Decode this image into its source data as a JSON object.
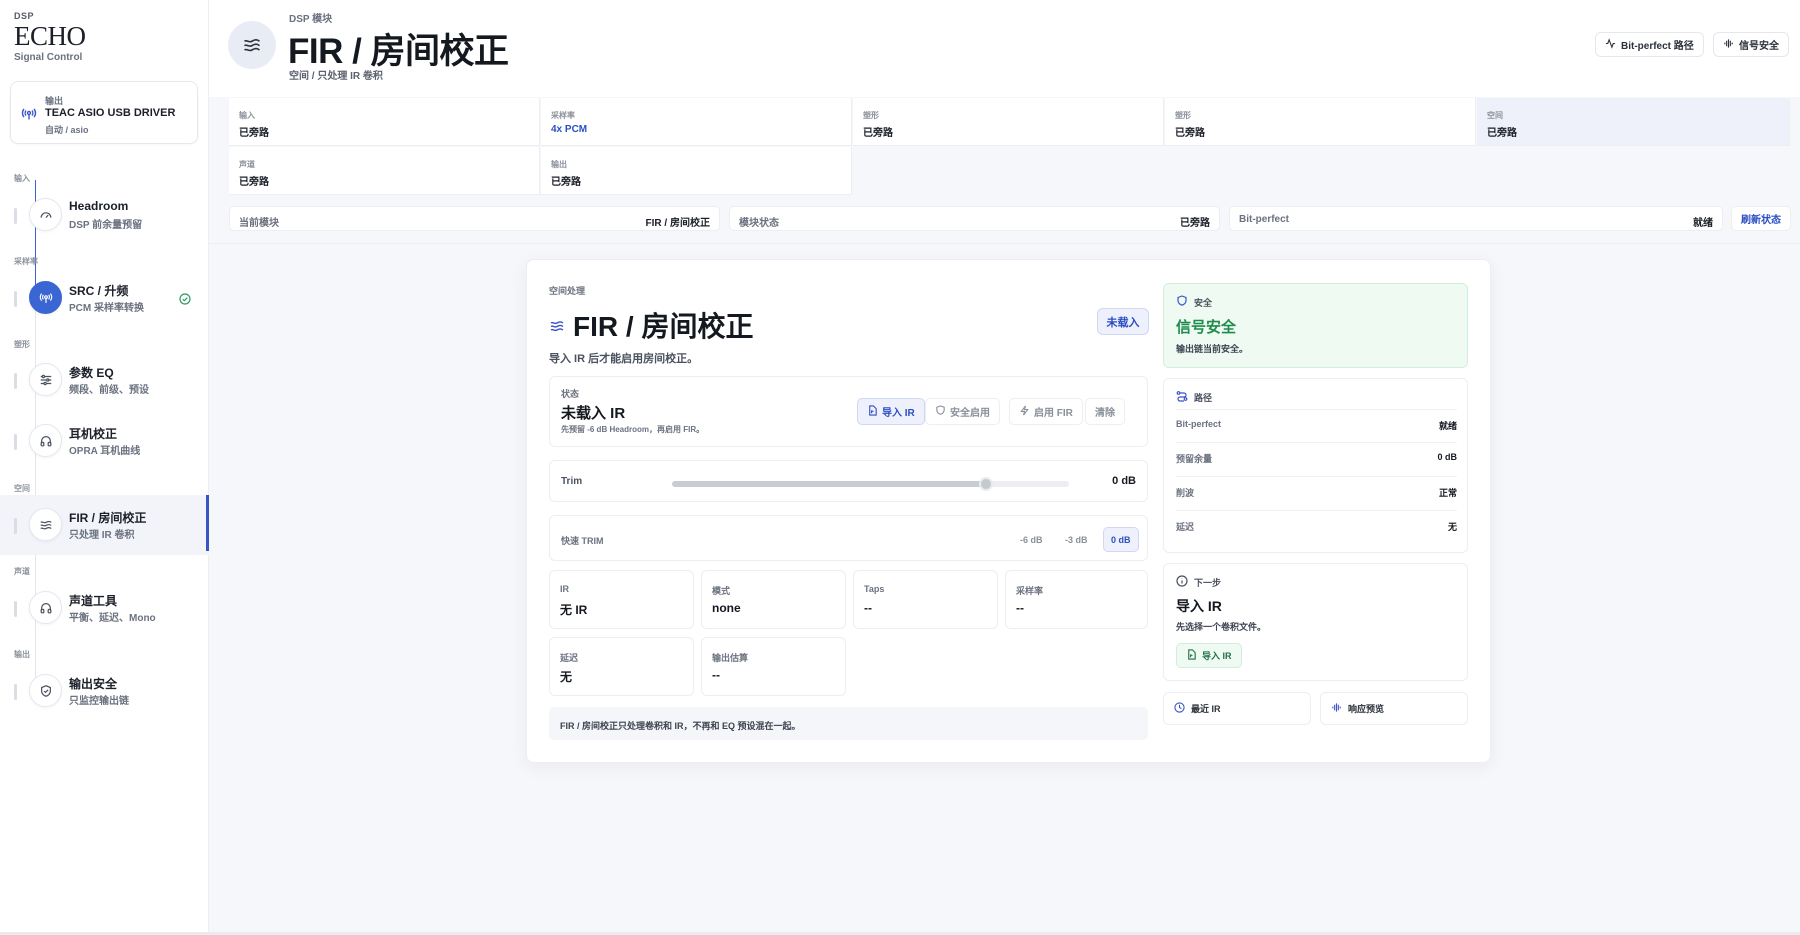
{
  "brand": {
    "small": "DSP",
    "title": "ECHO",
    "subtitle": "Signal Control"
  },
  "device": {
    "label": "输出",
    "name": "TEAC ASIO USB DRIVER",
    "sub": "自动 / asio"
  },
  "sidebar": {
    "sections": [
      "输入",
      "采样率",
      "塑形",
      "空间",
      "声道",
      "输出"
    ],
    "items": [
      {
        "title": "Headroom",
        "sub": "DSP 前余量预留",
        "icon": "gauge-icon"
      },
      {
        "title": "SRC / 升频",
        "sub": "PCM 采样率转换",
        "icon": "antenna-icon"
      },
      {
        "title": "参数 EQ",
        "sub": "频段、前级、预设",
        "icon": "sliders-icon"
      },
      {
        "title": "耳机校正",
        "sub": "OPRA 耳机曲线",
        "icon": "headphones-icon"
      },
      {
        "title": "FIR / 房间校正",
        "sub": "只处理 IR 卷积",
        "icon": "waves-icon"
      },
      {
        "title": "声道工具",
        "sub": "平衡、延迟、Mono",
        "icon": "headphones-icon"
      },
      {
        "title": "输出安全",
        "sub": "只监控输出链",
        "icon": "shield-icon"
      }
    ]
  },
  "header": {
    "overline": "DSP 模块",
    "title": "FIR / 房间校正",
    "subtitle": "空间 / 只处理 IR 卷积",
    "btn_bitperfect": "Bit-perfect 路径",
    "btn_safe": "信号安全"
  },
  "status_grid": [
    {
      "label": "输入",
      "value": "已旁路"
    },
    {
      "label": "采样率",
      "value": "4x PCM"
    },
    {
      "label": "塑形",
      "value": "已旁路"
    },
    {
      "label": "塑形",
      "value": "已旁路"
    },
    {
      "label": "空间",
      "value": "已旁路"
    },
    {
      "label": "声道",
      "value": "已旁路"
    },
    {
      "label": "输出",
      "value": "已旁路"
    }
  ],
  "status_row": [
    {
      "key": "当前模块",
      "value": "FIR / 房间校正"
    },
    {
      "key": "模块状态",
      "value": "已旁路"
    },
    {
      "key": "Bit-perfect",
      "value": "就绪"
    }
  ],
  "refresh_label": "刷新状态",
  "card": {
    "overline": "空间处理",
    "title": "FIR / 房间校正",
    "desc": "导入 IR 后才能启用房间校正。",
    "badge": "未载入",
    "state": {
      "label": "状态",
      "value": "未载入 IR",
      "hint": "先预留 -6 dB Headroom，再启用 FIR。",
      "actions": [
        "导入 IR",
        "安全启用",
        "启用 FIR",
        "清除"
      ]
    },
    "trim": {
      "label": "Trim",
      "value": "0 dB",
      "fraction": 0.79
    },
    "quick": {
      "label": "快速 TRIM",
      "options": [
        "-6 dB",
        "-3 dB",
        "0 dB"
      ],
      "selected": 2
    },
    "tiles": [
      {
        "label": "IR",
        "value": "无 IR"
      },
      {
        "label": "模式",
        "value": "none"
      },
      {
        "label": "Taps",
        "value": "--"
      },
      {
        "label": "采样率",
        "value": "--"
      },
      {
        "label": "延迟",
        "value": "无"
      },
      {
        "label": "输出估算",
        "value": "--"
      }
    ],
    "note": "FIR / 房间校正只处理卷积和 IR，不再和 EQ 预设混在一起。"
  },
  "safe": {
    "label": "安全",
    "value": "信号安全",
    "desc": "输出链当前安全。"
  },
  "path": {
    "label": "路径",
    "rows": [
      {
        "key": "Bit-perfect",
        "value": "就绪"
      },
      {
        "key": "预留余量",
        "value": "0 dB"
      },
      {
        "key": "削波",
        "value": "正常"
      },
      {
        "key": "延迟",
        "value": "无"
      }
    ]
  },
  "next_step": {
    "label": "下一步",
    "value": "导入 IR",
    "desc": "先选择一个卷积文件。",
    "button": "导入 IR"
  },
  "mini_buttons": [
    "最近 IR",
    "响应预览"
  ],
  "colors": {
    "accent": "#3a54c8",
    "safe": "#1f8b4c"
  }
}
